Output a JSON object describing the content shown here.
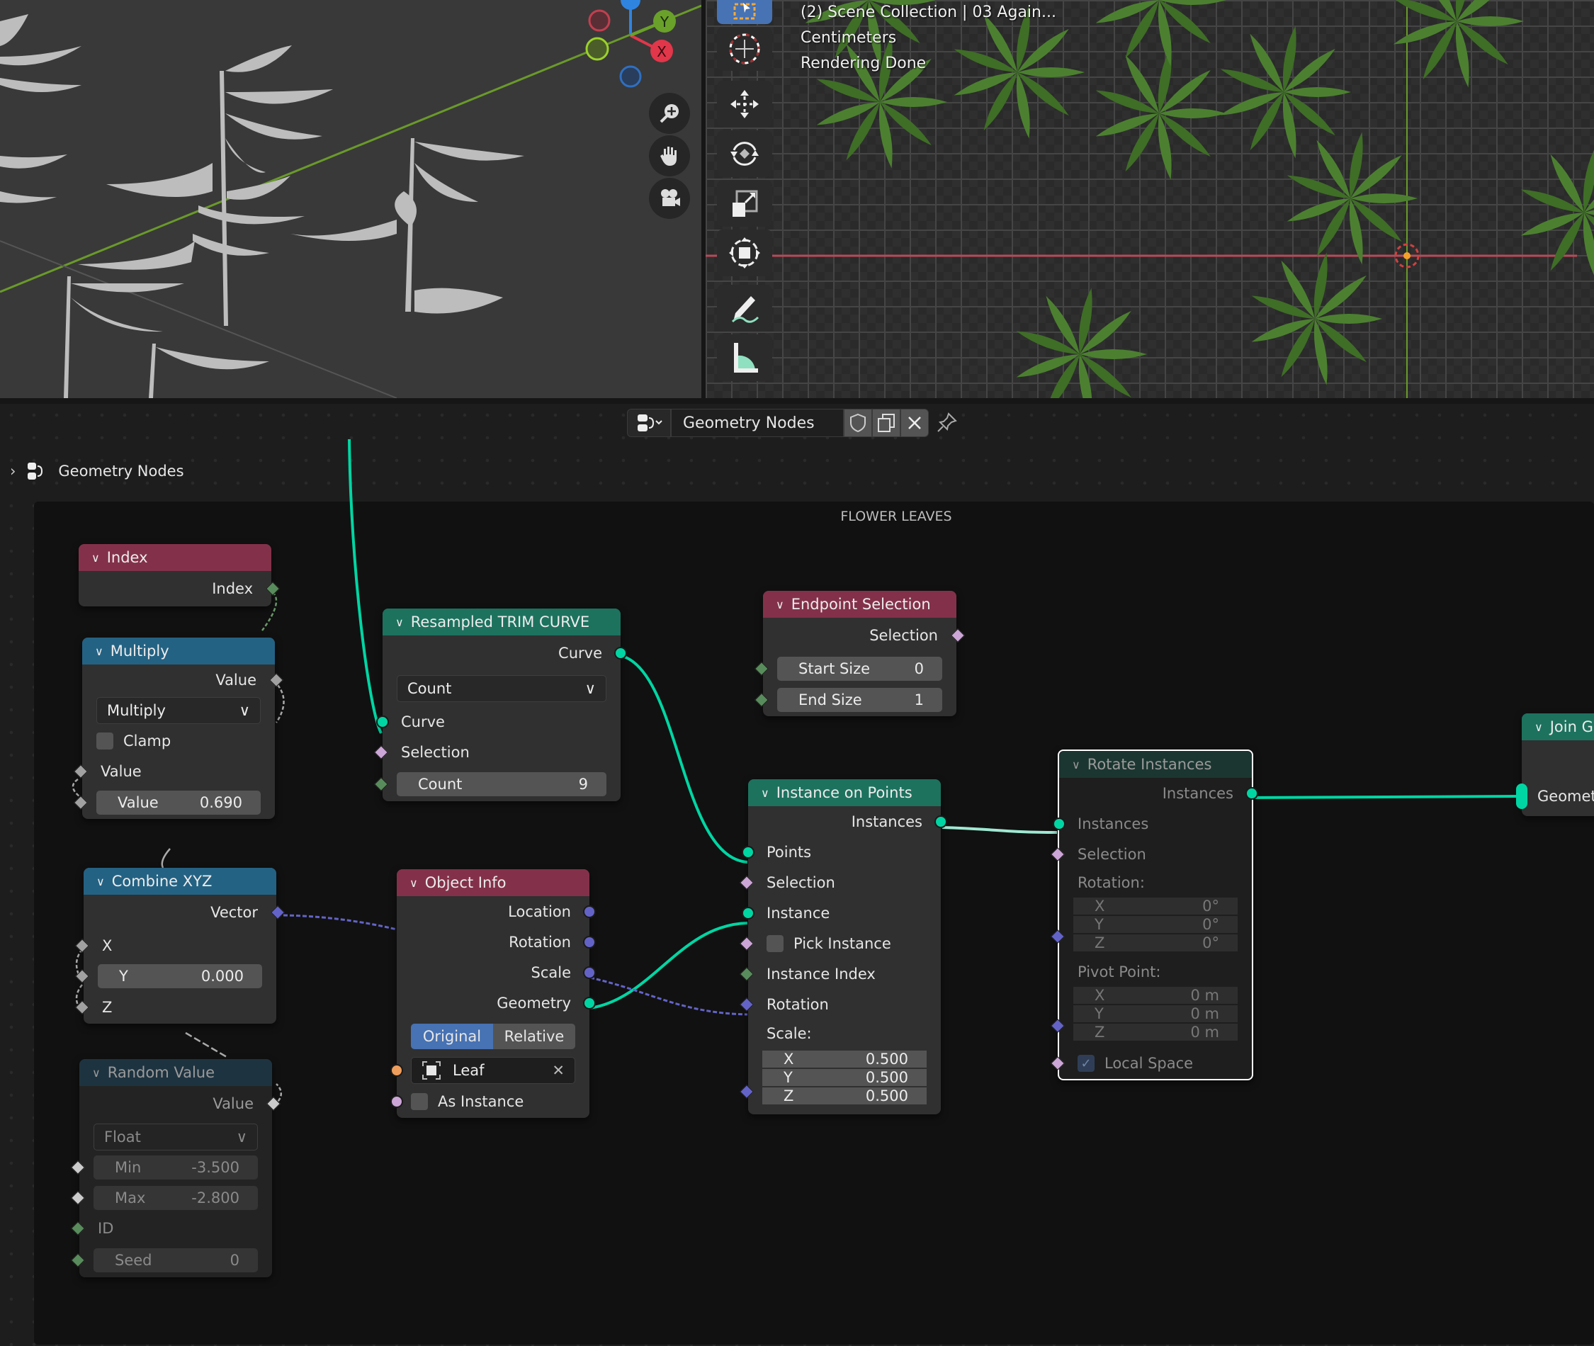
{
  "viewport3d": {
    "gizmo_axes": {
      "x": "X",
      "y": "Y"
    },
    "nav_buttons": [
      "zoom",
      "pan",
      "camera"
    ],
    "colors": {
      "x_axis": "#e2364a",
      "y_axis": "#6aa12a",
      "z_axis": "#2f84e0",
      "grid_line": "#6a9a2a"
    }
  },
  "viewport2d": {
    "overlay": {
      "scene_info": "(2) Scene Collection | 03 Again...",
      "units": "Centimeters",
      "render_status": "Rendering Done"
    },
    "tools": [
      "select-box",
      "cursor",
      "move",
      "rotate",
      "scale",
      "transform",
      "annotate",
      "measure"
    ]
  },
  "node_header": {
    "tree_name": "Geometry Nodes"
  },
  "breadcrumb": {
    "label": "Geometry Nodes"
  },
  "frame": {
    "label": "FLOWER LEAVES"
  },
  "colors": {
    "geometry_socket": "#00d6a3",
    "vector_socket": "#6363c7",
    "bool_socket": "#cca6d6",
    "int_socket": "#598c5c",
    "float_socket": "#a1a1a1",
    "object_socket": "#ed9e5c",
    "input_header": "#83314a",
    "converter_header": "#246283",
    "geometry_header": "#1d725e",
    "selected_outline": "#ffffff",
    "active_button": "#4772b3"
  },
  "nodes": {
    "index": {
      "title": "Index",
      "output": "Index"
    },
    "multiply": {
      "title": "Multiply",
      "output": "Value",
      "operation": "Multiply",
      "clamp_label": "Clamp",
      "input1": "Value",
      "input2_label": "Value",
      "input2_value": "0.690"
    },
    "combine_xyz": {
      "title": "Combine XYZ",
      "output": "Vector",
      "x": "X",
      "y_label": "Y",
      "y_value": "0.000",
      "z": "Z"
    },
    "random_value": {
      "title": "Random Value",
      "output": "Value",
      "type": "Float",
      "min_label": "Min",
      "min_value": "-3.500",
      "max_label": "Max",
      "max_value": "-2.800",
      "id": "ID",
      "seed_label": "Seed",
      "seed_value": "0"
    },
    "resample": {
      "title": "Resampled TRIM CURVE",
      "output": "Curve",
      "mode": "Count",
      "curve": "Curve",
      "selection": "Selection",
      "count_label": "Count",
      "count_value": "9"
    },
    "object_info": {
      "title": "Object Info",
      "outputs": [
        "Location",
        "Rotation",
        "Scale",
        "Geometry"
      ],
      "mode_original": "Original",
      "mode_relative": "Relative",
      "object": "Leaf",
      "as_instance": "As Instance"
    },
    "endpoint": {
      "title": "Endpoint Selection",
      "output": "Selection",
      "start_label": "Start Size",
      "start_value": "0",
      "end_label": "End Size",
      "end_value": "1"
    },
    "instance_on_points": {
      "title": "Instance on Points",
      "output": "Instances",
      "points": "Points",
      "selection": "Selection",
      "instance": "Instance",
      "pick_instance": "Pick Instance",
      "instance_index": "Instance Index",
      "rotation": "Rotation",
      "scale_label": "Scale:",
      "scale": [
        {
          "axis": "X",
          "value": "0.500"
        },
        {
          "axis": "Y",
          "value": "0.500"
        },
        {
          "axis": "Z",
          "value": "0.500"
        }
      ]
    },
    "rotate_instances": {
      "title": "Rotate Instances",
      "output": "Instances",
      "instances": "Instances",
      "selection": "Selection",
      "rotation_label": "Rotation:",
      "rotation": [
        {
          "axis": "X",
          "value": "0°"
        },
        {
          "axis": "Y",
          "value": "0°"
        },
        {
          "axis": "Z",
          "value": "0°"
        }
      ],
      "pivot_label": "Pivot Point:",
      "pivot": [
        {
          "axis": "X",
          "value": "0 m"
        },
        {
          "axis": "Y",
          "value": "0 m"
        },
        {
          "axis": "Z",
          "value": "0 m"
        }
      ],
      "local_space": "Local Space",
      "local_space_checked": true
    },
    "join_geometry": {
      "title": "Join G",
      "input": "Geomet"
    }
  }
}
